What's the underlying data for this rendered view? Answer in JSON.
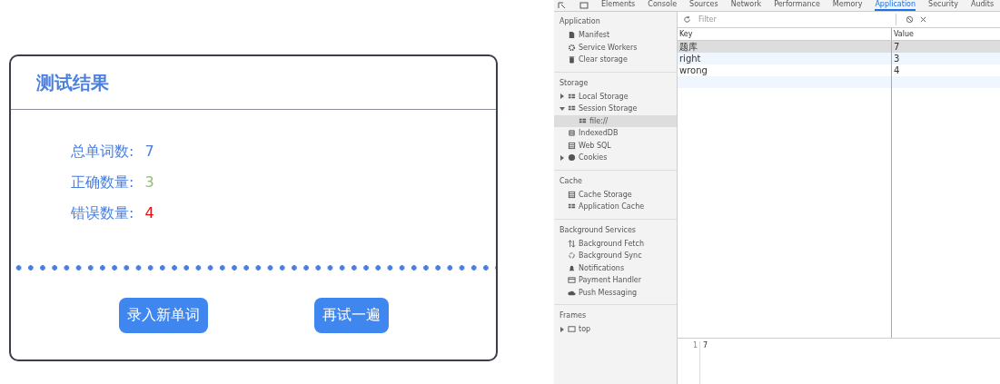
{
  "result_card": {
    "title": "测试结果",
    "stats": [
      {
        "label": "总单词数:",
        "value": "7",
        "color": "#4a7fe0"
      },
      {
        "label": "正确数量:",
        "value": "3",
        "color": "#8fbf73"
      },
      {
        "label": "错误数量:",
        "value": "4",
        "color": "#e01010"
      }
    ],
    "buttons": [
      "录入新单词",
      "再试一遍"
    ]
  },
  "devtools": {
    "tabs": [
      {
        "label": "Elements",
        "selected": false
      },
      {
        "label": "Console",
        "selected": false
      },
      {
        "label": "Sources",
        "selected": false
      },
      {
        "label": "Network",
        "selected": false
      },
      {
        "label": "Performance",
        "selected": false
      },
      {
        "label": "Memory",
        "selected": false
      },
      {
        "label": "Application",
        "selected": true
      },
      {
        "label": "Security",
        "selected": false
      },
      {
        "label": "Audits",
        "selected": false
      }
    ],
    "sidebar": [
      {
        "title": "Application",
        "items": [
          {
            "label": "Manifest",
            "kind": "file",
            "selected": false
          },
          {
            "label": "Service Workers",
            "kind": "gear",
            "selected": false
          },
          {
            "label": "Clear storage",
            "kind": "trash",
            "selected": false
          }
        ]
      },
      {
        "title": "Storage",
        "items": [
          {
            "label": "Local Storage",
            "kind": "grid",
            "expanded": false,
            "selected": false
          },
          {
            "label": "Session Storage",
            "kind": "grid",
            "expanded": true,
            "selected": false,
            "children": [
              {
                "label": "file://",
                "kind": "grid",
                "selected": true
              }
            ]
          },
          {
            "label": "IndexedDB",
            "kind": "database",
            "selected": false
          },
          {
            "label": "Web SQL",
            "kind": "table",
            "selected": false
          },
          {
            "label": "Cookies",
            "kind": "cookie",
            "expanded": false,
            "selected": false
          }
        ]
      },
      {
        "title": "Cache",
        "items": [
          {
            "label": "Cache Storage",
            "kind": "table",
            "selected": false
          },
          {
            "label": "Application Cache",
            "kind": "grid",
            "selected": false
          }
        ]
      },
      {
        "title": "Background Services",
        "items": [
          {
            "label": "Background Fetch",
            "kind": "arrows",
            "selected": false
          },
          {
            "label": "Background Sync",
            "kind": "sync",
            "selected": false
          },
          {
            "label": "Notifications",
            "kind": "bell",
            "selected": false
          },
          {
            "label": "Payment Handler",
            "kind": "card",
            "selected": false
          },
          {
            "label": "Push Messaging",
            "kind": "cloud",
            "selected": false
          }
        ]
      },
      {
        "title": "Frames",
        "items": [
          {
            "label": "top",
            "kind": "frame",
            "expanded": false,
            "selected": false
          }
        ]
      }
    ],
    "filter": {
      "placeholder": "Filter"
    },
    "table": {
      "columns": [
        "Key",
        "Value"
      ],
      "rows": [
        {
          "key": "题库",
          "value": "7",
          "selected": true
        },
        {
          "key": "right",
          "value": "3",
          "selected": false
        },
        {
          "key": "wrong",
          "value": "4",
          "selected": false
        }
      ]
    },
    "editor": {
      "line_number": "1",
      "content": "7"
    }
  }
}
